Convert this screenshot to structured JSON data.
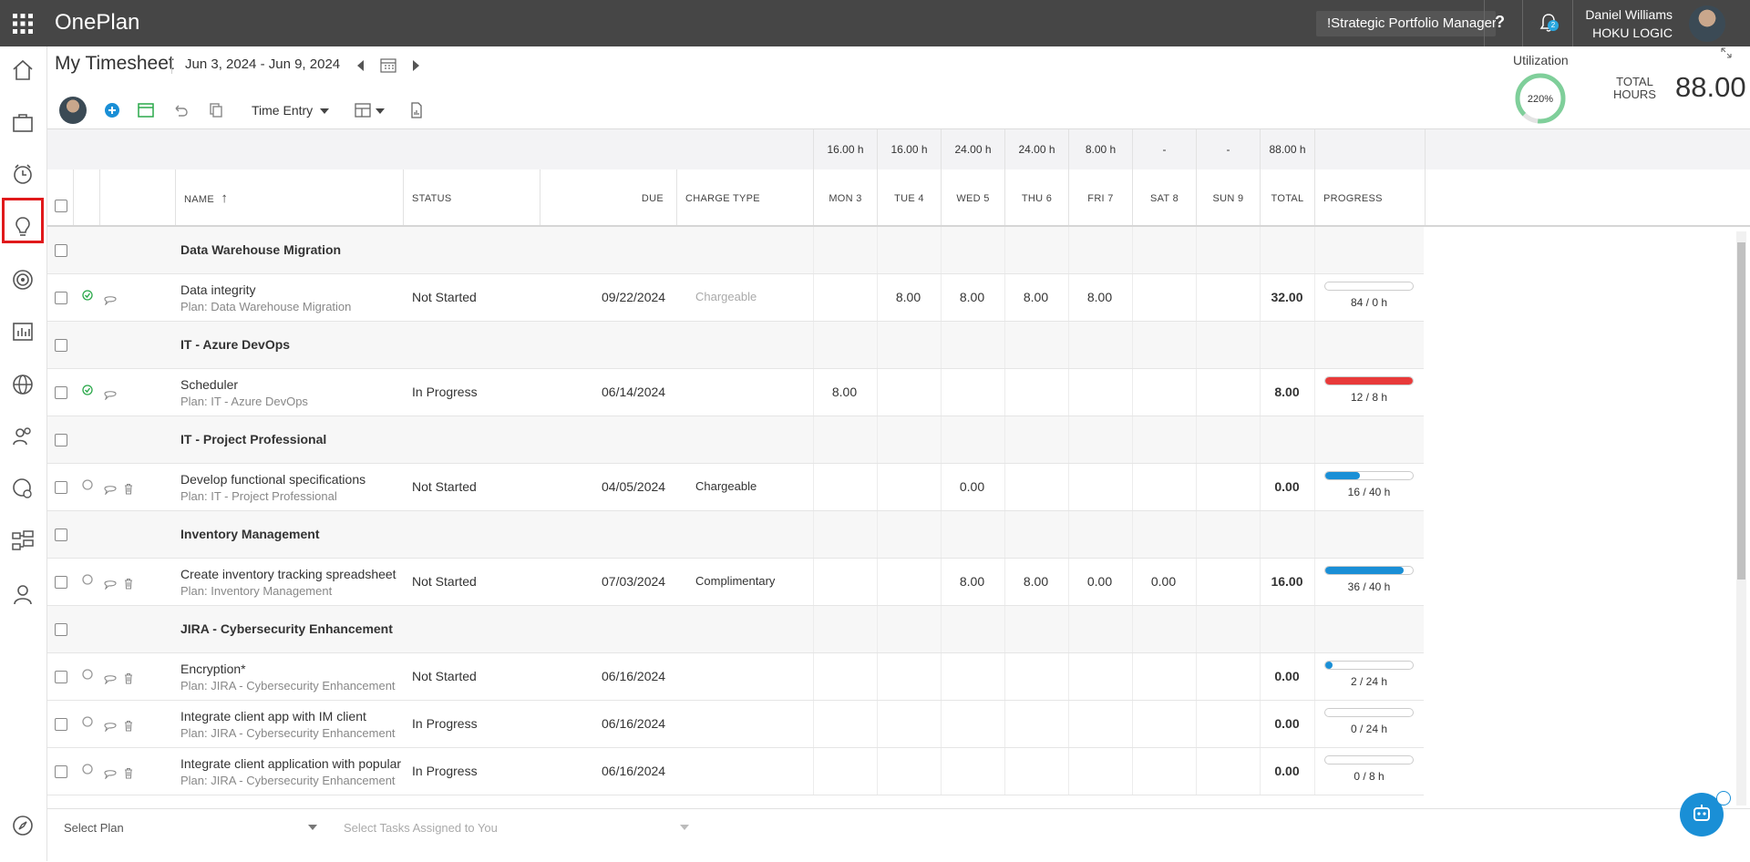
{
  "app": {
    "title": "OnePlan",
    "portfolio": "!Strategic Portfolio Manager",
    "help": "?",
    "notification_count": "2",
    "user_name": "Daniel Williams",
    "user_org": "HOKU LOGIC"
  },
  "sidebar": {
    "items": [
      "home-icon",
      "briefcase-icon",
      "timesheet-icon",
      "lightbulb-icon",
      "target-icon",
      "chart-icon",
      "globe-icon",
      "people-icon",
      "globe-settings-icon",
      "hierarchy-icon",
      "user-icon",
      "compass-icon"
    ],
    "active": "timesheet-icon"
  },
  "page": {
    "title": "My Timesheet",
    "date_range": "Jun 3, 2024 - Jun 9, 2024",
    "utilization_label": "Utilization",
    "utilization_value": "220%",
    "total_hours_label_1": "TOTAL",
    "total_hours_label_2": "HOURS",
    "total_hours_value": "88.00"
  },
  "toolbar": {
    "time_entry": "Time Entry"
  },
  "columns": {
    "name": "NAME",
    "status": "STATUS",
    "due": "DUE",
    "charge_type": "CHARGE TYPE",
    "days": [
      "MON 3",
      "TUE 4",
      "WED 5",
      "THU 6",
      "FRI 7",
      "SAT 8",
      "SUN 9"
    ],
    "total": "TOTAL",
    "progress": "PROGRESS"
  },
  "day_totals": [
    "16.00 h",
    "16.00 h",
    "24.00 h",
    "24.00 h",
    "8.00 h",
    "-",
    "-"
  ],
  "grand_total": "88.00 h",
  "rows": [
    {
      "type": "group",
      "name": "Data Warehouse Migration"
    },
    {
      "type": "task",
      "name": "Data integrity",
      "plan": "Plan: Data Warehouse Migration",
      "status": "Not Started",
      "due": "09/22/2024",
      "charge": "Chargeable",
      "charge_light": true,
      "hours": [
        "",
        "8.00",
        "8.00",
        "8.00",
        "8.00",
        "",
        ""
      ],
      "total": "32.00",
      "progress_text": "84 / 0 h",
      "progress": 0,
      "progress_color": "#1a8fd6",
      "state": "check",
      "trash": false
    },
    {
      "type": "group",
      "name": "IT - Azure DevOps"
    },
    {
      "type": "task",
      "name": "Scheduler",
      "plan": "Plan: IT - Azure DevOps",
      "status": "In Progress",
      "due": "06/14/2024",
      "charge": "",
      "charge_light": false,
      "hours": [
        "8.00",
        "",
        "",
        "",
        "",
        "",
        ""
      ],
      "total": "8.00",
      "progress_text": "12 / 8 h",
      "progress": 1,
      "progress_color": "#e83a3a",
      "state": "check",
      "trash": false
    },
    {
      "type": "group",
      "name": "IT - Project Professional"
    },
    {
      "type": "task",
      "name": "Develop functional specifications",
      "plan": "Plan: IT - Project Professional",
      "status": "Not Started",
      "due": "04/05/2024",
      "charge": "Chargeable",
      "charge_light": false,
      "hours": [
        "",
        "",
        "0.00",
        "",
        "",
        "",
        ""
      ],
      "total": "0.00",
      "progress_text": "16 / 40 h",
      "progress": 0.4,
      "progress_color": "#1a8fd6",
      "state": "circle",
      "trash": true
    },
    {
      "type": "group",
      "name": "Inventory Management"
    },
    {
      "type": "task",
      "name": "Create inventory tracking spreadsheet",
      "plan": "Plan: Inventory Management",
      "status": "Not Started",
      "due": "07/03/2024",
      "charge": "Complimentary",
      "charge_light": false,
      "hours": [
        "",
        "",
        "8.00",
        "8.00",
        "0.00",
        "0.00",
        ""
      ],
      "total": "16.00",
      "progress_text": "36 / 40 h",
      "progress": 0.9,
      "progress_color": "#1a8fd6",
      "state": "circle",
      "trash": true
    },
    {
      "type": "group",
      "name": "JIRA - Cybersecurity Enhancement"
    },
    {
      "type": "task",
      "name": "Encryption*",
      "plan": "Plan: JIRA - Cybersecurity Enhancement",
      "status": "Not Started",
      "due": "06/16/2024",
      "charge": "",
      "charge_light": false,
      "hours": [
        "",
        "",
        "",
        "",
        "",
        "",
        ""
      ],
      "total": "0.00",
      "progress_text": "2 / 24 h",
      "progress": 0.083,
      "progress_color": "#1a8fd6",
      "state": "circle",
      "trash": true
    },
    {
      "type": "task",
      "name": "Integrate client app with IM client",
      "plan": "Plan: JIRA - Cybersecurity Enhancement",
      "status": "In Progress",
      "due": "06/16/2024",
      "charge": "",
      "charge_light": false,
      "hours": [
        "",
        "",
        "",
        "",
        "",
        "",
        ""
      ],
      "total": "0.00",
      "progress_text": "0 / 24 h",
      "progress": 0,
      "progress_color": "#1a8fd6",
      "state": "circle",
      "trash": true
    },
    {
      "type": "task",
      "name": "Integrate client application with popular",
      "plan": "Plan: JIRA - Cybersecurity Enhancement",
      "status": "In Progress",
      "due": "06/16/2024",
      "charge": "",
      "charge_light": false,
      "hours": [
        "",
        "",
        "",
        "",
        "",
        "",
        ""
      ],
      "total": "0.00",
      "progress_text": "0 / 8 h",
      "progress": 0,
      "progress_color": "#1a8fd6",
      "state": "circle",
      "trash": true
    }
  ],
  "footer": {
    "select_plan": "Select Plan",
    "select_tasks": "Select Tasks Assigned to You"
  }
}
